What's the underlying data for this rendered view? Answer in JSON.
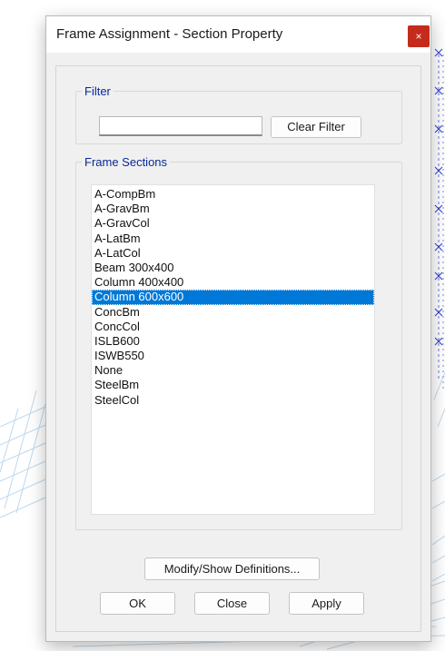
{
  "window": {
    "title": "Frame Assignment - Section Property",
    "close_glyph": "×"
  },
  "filter": {
    "legend": "Filter",
    "input_value": "",
    "clear_label": "Clear Filter"
  },
  "frame_sections": {
    "legend": "Frame Sections",
    "items": [
      "A-CompBm",
      "A-GravBm",
      "A-GravCol",
      "A-LatBm",
      "A-LatCol",
      "Beam 300x400",
      "Column 400x400",
      "Column 600x600",
      "ConcBm",
      "ConcCol",
      "ISLB600",
      "ISWB550",
      "None",
      "SteelBm",
      "SteelCol"
    ],
    "selected_index": 7
  },
  "buttons": {
    "modify_label": "Modify/Show Definitions...",
    "ok_label": "OK",
    "close_label": "Close",
    "apply_label": "Apply"
  },
  "colors": {
    "selection": "#0078d7",
    "close_button": "#c42b1c",
    "group_label": "#0a2896",
    "background_grid": "#b7d4ea",
    "model_markers": "#2a3fd1"
  }
}
